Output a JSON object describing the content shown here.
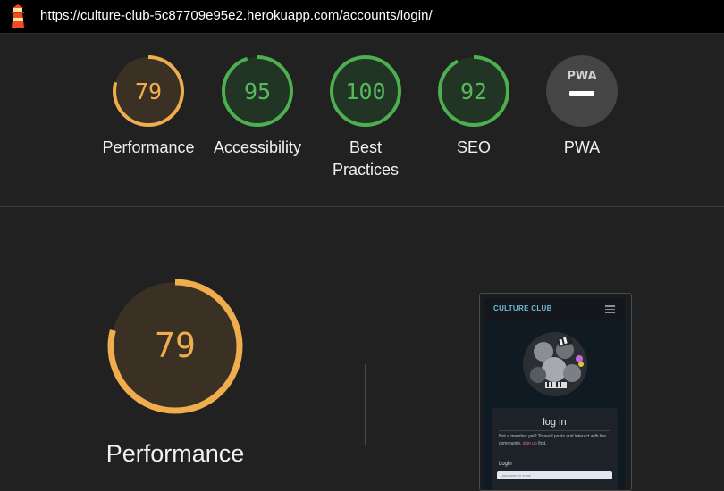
{
  "address_bar": {
    "url": "https://culture-club-5c87709e95e2.herokuapp.com/accounts/login/"
  },
  "colors": {
    "average": "#f0ad4e",
    "pass": "#4caf50",
    "pass_text": "#57b85d",
    "neutral": "#454545"
  },
  "summary": [
    {
      "key": "performance",
      "score": 79,
      "label": "Performance",
      "status": "average"
    },
    {
      "key": "accessibility",
      "score": 95,
      "label": "Accessibility",
      "status": "pass"
    },
    {
      "key": "best-practices",
      "score": 100,
      "label": "Best Practices",
      "label_lines": [
        "Best",
        "Practices"
      ],
      "status": "pass"
    },
    {
      "key": "seo",
      "score": 92,
      "label": "SEO",
      "status": "pass"
    },
    {
      "key": "pwa",
      "score": null,
      "label": "PWA",
      "badge": "PWA",
      "status": "neutral"
    }
  ],
  "detail": {
    "score": 79,
    "label": "Performance"
  },
  "screenshot": {
    "brand": "CULTURE CLUB",
    "heading": "log in",
    "intro": "Not a member yet? To read posts and interact with the community,",
    "intro_link": "sign up",
    "intro_end": "first.",
    "login_label": "Login",
    "login_placeholder": "Username or email"
  }
}
